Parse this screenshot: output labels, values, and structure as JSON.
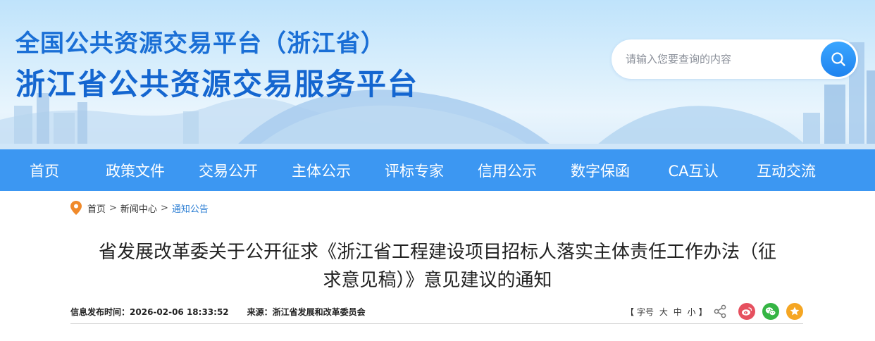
{
  "header": {
    "title_line1": "全国公共资源交易平台（浙江省）",
    "title_line2": "浙江省公共资源交易服务平台"
  },
  "search": {
    "placeholder": "请输入您要查询的内容"
  },
  "nav": {
    "items": [
      {
        "label": "首页"
      },
      {
        "label": "政策文件"
      },
      {
        "label": "交易公开"
      },
      {
        "label": "主体公示"
      },
      {
        "label": "评标专家"
      },
      {
        "label": "信用公示"
      },
      {
        "label": "数字保函"
      },
      {
        "label": "CA互认"
      },
      {
        "label": "互动交流"
      }
    ]
  },
  "breadcrumb": {
    "items": [
      "首页",
      "新闻中心",
      "通知公告"
    ],
    "separator": ">"
  },
  "article": {
    "title_line1": "省发展改革委关于公开征求《浙江省工程建设项目招标人落实主体责任工作办法（征",
    "title_line2": "求意见稿）》意见建议的通知",
    "publish_label": "信息发布时间：",
    "publish_time": "2026-02-06 18:33:52",
    "source_label": "来源：",
    "source": "浙江省发展和改革委员会"
  },
  "font_size_control": {
    "open": "【",
    "label": "字号",
    "large": "大",
    "medium": "中",
    "small": "小",
    "close": "】"
  },
  "share": {
    "icons": [
      "share-icon",
      "weibo-icon",
      "wechat-icon",
      "favorite-icon"
    ],
    "colors": {
      "weibo": "#e6505f",
      "wechat": "#35b544",
      "favorite": "#f5a623"
    }
  },
  "colors": {
    "nav_bg": "#3c97f2",
    "title_blue": "#1466d0",
    "link_blue": "#2d7fd4",
    "pin_orange": "#f08a2b"
  }
}
